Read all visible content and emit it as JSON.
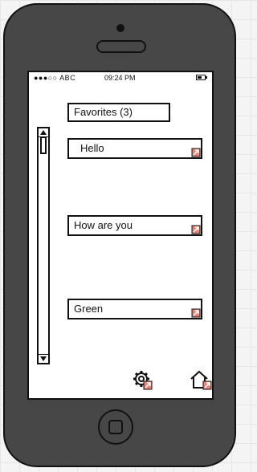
{
  "status_bar": {
    "carrier": "●●●○○ ABC",
    "time": "09:24 PM"
  },
  "favorites": {
    "title": "Favorites (3)",
    "items": [
      {
        "label": "Hello"
      },
      {
        "label": "How are you"
      },
      {
        "label": "Green"
      }
    ]
  },
  "toolbar": {
    "settings_icon": "gear-icon",
    "home_icon": "home-icon"
  },
  "colors": {
    "phone_body": "#474747",
    "outline": "#111111",
    "link_arrow": "#e6857c",
    "screen": "#ffffff"
  }
}
